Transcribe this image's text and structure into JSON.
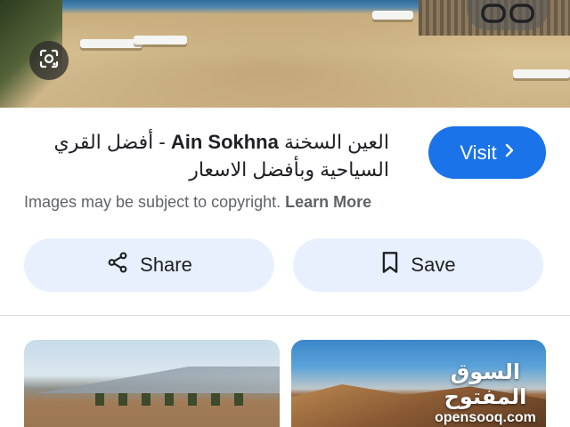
{
  "hero": {
    "lens_icon": "google-lens-icon",
    "control_icon": "carousel-control-icon"
  },
  "result": {
    "title_ar_before": "العين السخنة",
    "title_en": "Ain Sokhna",
    "title_ar_after": "- أفضل القري السياحية وبأفضل الاسعار",
    "copyright_text": "Images may be subject to copyright.",
    "learn_more": "Learn More"
  },
  "actions": {
    "visit_label": "Visit",
    "visit_icon": "chevron-right-icon",
    "share_label": "Share",
    "share_icon": "share-icon",
    "save_label": "Save",
    "save_icon": "bookmark-icon"
  },
  "related": {
    "watermark_ar": "السوق المفتوح",
    "watermark_latin": "opensooq.com"
  },
  "colors": {
    "visit_bg": "#1a73e8",
    "pill_bg": "#e8f0fe",
    "text_primary": "#202124",
    "text_secondary": "#5f6368"
  }
}
